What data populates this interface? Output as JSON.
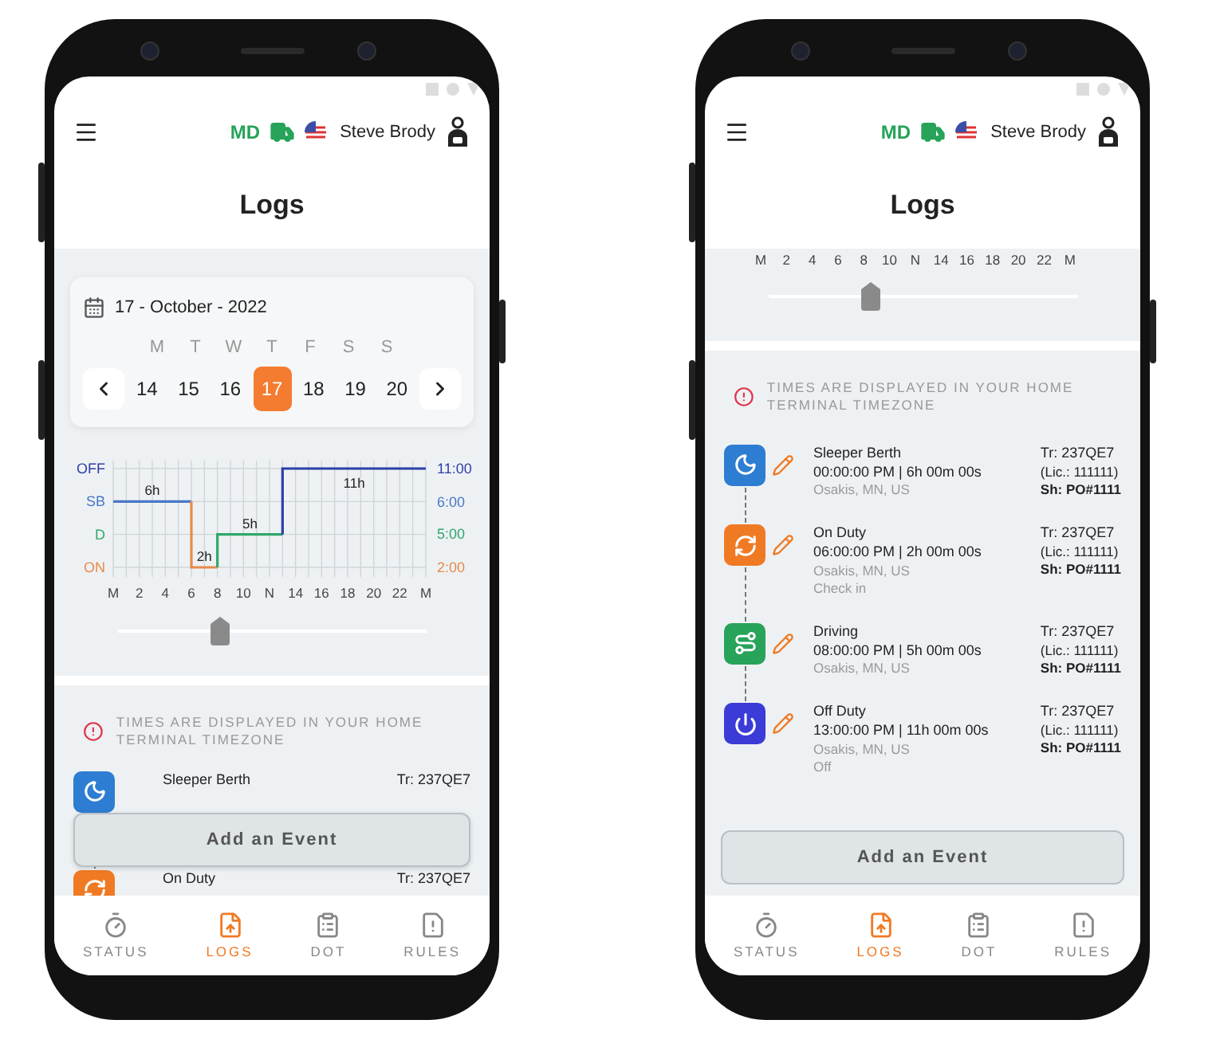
{
  "phones": [
    {
      "header": {
        "code": "MD",
        "user": "Steve Brody"
      },
      "title": "Logs",
      "date_card": {
        "date": "17 - October - 2022",
        "weekdays": [
          "M",
          "T",
          "W",
          "T",
          "F",
          "S",
          "S"
        ],
        "days": [
          {
            "label": "14",
            "selected": false
          },
          {
            "label": "15",
            "selected": false
          },
          {
            "label": "16",
            "selected": false
          },
          {
            "label": "17",
            "selected": true
          },
          {
            "label": "18",
            "selected": false
          },
          {
            "label": "19",
            "selected": false
          },
          {
            "label": "20",
            "selected": false
          }
        ]
      },
      "log_graph": {
        "duty_rows": [
          {
            "label": "OFF",
            "total": "11:00",
            "color": "#2c3ea8"
          },
          {
            "label": "SB",
            "total": "6:00",
            "color": "#4a78c8"
          },
          {
            "label": "D",
            "total": "5:00",
            "color": "#2fa86a"
          },
          {
            "label": "ON",
            "total": "2:00",
            "color": "#e88a4a"
          }
        ],
        "hour_labels": [
          "M",
          "2",
          "4",
          "6",
          "8",
          "10",
          "N",
          "14",
          "16",
          "18",
          "20",
          "22",
          "M"
        ],
        "durations": [
          "6h",
          "2h",
          "5h",
          "11h"
        ]
      },
      "slider": {
        "level": 0.33
      },
      "notice": "TIMES ARE DISPLAYED IN YOUR HOME TERMINAL TIMEZONE",
      "events": [
        {
          "kind": "sleeper",
          "color": "#2d7dd2",
          "editable": false,
          "name": "Sleeper Berth",
          "tr": "Tr: 237QE7"
        },
        {
          "kind": "on_duty",
          "color": "#f07a24",
          "editable": false,
          "name": "On Duty",
          "tr": "Tr: 237QE7"
        }
      ],
      "add_button": "Add an Event",
      "tabs": [
        {
          "label": "STATUS",
          "selected": false
        },
        {
          "label": "LOGS",
          "selected": true
        },
        {
          "label": "DOT",
          "selected": false
        },
        {
          "label": "RULES",
          "selected": false
        }
      ]
    },
    {
      "header": {
        "code": "MD",
        "user": "Steve Brody"
      },
      "title": "Logs",
      "hour_labels": [
        "M",
        "2",
        "4",
        "6",
        "8",
        "10",
        "N",
        "14",
        "16",
        "18",
        "20",
        "22",
        "M"
      ],
      "slider": {
        "level": 0.33
      },
      "notice": "TIMES ARE DISPLAYED IN YOUR HOME TERMINAL TIMEZONE",
      "events": [
        {
          "kind": "sleeper",
          "color": "#2d7dd2",
          "editable": true,
          "name": "Sleeper Berth",
          "time": "00:00:00 PM | 6h 00m 00s",
          "location": "Osakis, MN, US",
          "tr": "Tr: 237QE7",
          "lic": "(Lic.: 111111)",
          "sh": "Sh: PO#1111"
        },
        {
          "kind": "on_duty",
          "color": "#f07a24",
          "editable": true,
          "name": "On Duty",
          "time": "06:00:00 PM | 2h 00m 00s",
          "location": "Osakis, MN, US",
          "note": "Check in",
          "tr": "Tr: 237QE7",
          "lic": "(Lic.: 111111)",
          "sh": "Sh: PO#1111"
        },
        {
          "kind": "driving",
          "color": "#27a35a",
          "editable": true,
          "name": "Driving",
          "time": "08:00:00 PM | 5h 00m 00s",
          "location": "Osakis, MN, US",
          "tr": "Tr: 237QE7",
          "lic": "(Lic.: 111111)",
          "sh": "Sh: PO#1111"
        },
        {
          "kind": "off_duty",
          "color": "#3b3bd8",
          "editable": true,
          "name": "Off Duty",
          "time": "13:00:00 PM | 11h 00m 00s",
          "location": "Osakis, MN, US",
          "note": "Off",
          "tr": "Tr: 237QE7",
          "lic": "(Lic.: 111111)",
          "sh": "Sh: PO#1111"
        }
      ],
      "add_button": "Add an Event",
      "tabs": [
        {
          "label": "STATUS",
          "selected": false
        },
        {
          "label": "LOGS",
          "selected": true
        },
        {
          "label": "DOT",
          "selected": false
        },
        {
          "label": "RULES",
          "selected": false
        }
      ]
    }
  ]
}
